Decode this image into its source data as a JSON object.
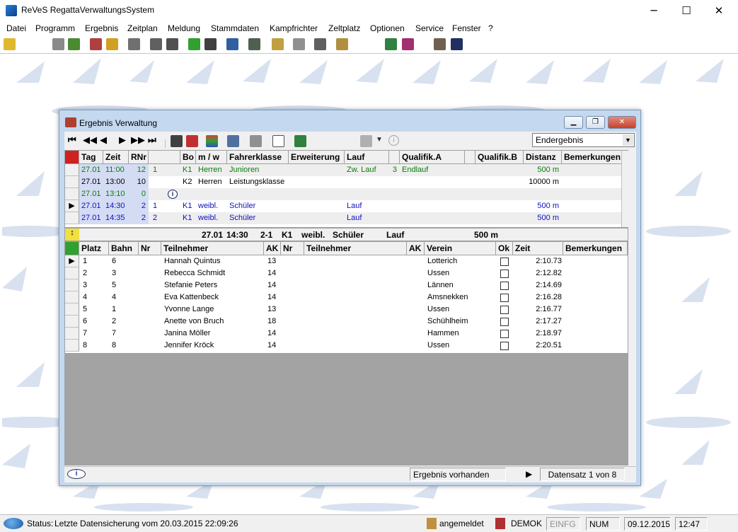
{
  "app": {
    "title": "ReVeS  RegattaVerwaltungsSystem"
  },
  "menu": [
    "Datei",
    "Programm",
    "Ergebnis",
    "Zeitplan",
    "Meldung",
    "Stammdaten",
    "Kampfrichter",
    "Zeltplatz",
    "Optionen",
    "Service",
    "Fenster",
    "?"
  ],
  "child": {
    "title": "Ergebnis Verwaltung",
    "combo_value": "Endergebnis",
    "upper_headers": [
      "Tag",
      "Zeit",
      "RNr",
      "",
      "Bo",
      "m / w",
      "Fahrerklasse",
      "Erweiterung",
      "Lauf",
      "",
      "Qualifik.A",
      "",
      "Qualifik.B",
      "Distanz",
      "Bemerkungen"
    ],
    "upper_rows": [
      {
        "tag": "27.01",
        "zeit": "11:00",
        "rnr": "12",
        "x": "1",
        "bo": "K1",
        "mw": "Herren",
        "klasse": "Junioren",
        "erw": "",
        "lauf": "Zw. Lauf",
        "n": "3",
        "qa": "Endlauf",
        "qb": "",
        "dist": "500 m",
        "color": "#0b7a0b"
      },
      {
        "tag": "27.01",
        "zeit": "13:00",
        "rnr": "10",
        "x": "",
        "bo": "K2",
        "mw": "Herren",
        "klasse": "Leistungsklasse",
        "erw": "",
        "lauf": "",
        "n": "",
        "qa": "",
        "qb": "",
        "dist": "10000 m",
        "color": "#000000"
      },
      {
        "tag": "27.01",
        "zeit": "13:10",
        "rnr": "0",
        "x": "",
        "bo": "",
        "mw": "",
        "klasse": "",
        "erw": "",
        "lauf": "",
        "n": "",
        "qa": "",
        "qb": "",
        "dist": "",
        "color": "#0b7a0b"
      },
      {
        "tag": "27.01",
        "zeit": "14:30",
        "rnr": "2",
        "x": "1",
        "bo": "K1",
        "mw": "weibl.",
        "klasse": "Schüler",
        "erw": "",
        "lauf": "Lauf",
        "n": "",
        "qa": "",
        "qb": "",
        "dist": "500 m",
        "color": "#1010c0"
      },
      {
        "tag": "27.01",
        "zeit": "14:35",
        "rnr": "2",
        "x": "2",
        "bo": "K1",
        "mw": "weibl.",
        "klasse": "Schüler",
        "erw": "",
        "lauf": "Lauf",
        "n": "",
        "qa": "",
        "qb": "",
        "dist": "500 m",
        "color": "#1010c0"
      }
    ],
    "summary": {
      "tag": "27.01",
      "zeit": "14:30",
      "nr": "2-1",
      "bo": "K1",
      "mw": "weibl.",
      "klasse": "Schüler",
      "lauf": "Lauf",
      "dist": "500 m"
    },
    "lower_headers": [
      "Platz",
      "Bahn",
      "Nr",
      "Teilnehmer",
      "AK",
      "Nr",
      "Teilnehmer",
      "AK",
      "Verein",
      "Ok",
      "Zeit",
      "Bemerkungen"
    ],
    "lower_rows": [
      {
        "platz": "1",
        "bahn": "6",
        "name": "Hannah Quintus",
        "ak": "13",
        "verein": "Lotterich",
        "zeit": "2:10.73"
      },
      {
        "platz": "2",
        "bahn": "3",
        "name": "Rebecca Schmidt",
        "ak": "14",
        "verein": "Ussen",
        "zeit": "2:12.82"
      },
      {
        "platz": "3",
        "bahn": "5",
        "name": "Stefanie Peters",
        "ak": "14",
        "verein": "Lännen",
        "zeit": "2:14.69"
      },
      {
        "platz": "4",
        "bahn": "4",
        "name": "Eva Kattenbeck",
        "ak": "14",
        "verein": "Amsnekken",
        "zeit": "2:16.28"
      },
      {
        "platz": "5",
        "bahn": "1",
        "name": "Yvonne Lange",
        "ak": "13",
        "verein": "Ussen",
        "zeit": "2:16.77"
      },
      {
        "platz": "6",
        "bahn": "2",
        "name": "Anette von Bruch",
        "ak": "18",
        "verein": "Schühlheim",
        "zeit": "2:17.27"
      },
      {
        "platz": "7",
        "bahn": "7",
        "name": "Janina Möller",
        "ak": "14",
        "verein": "Hammen",
        "zeit": "2:18.97"
      },
      {
        "platz": "8",
        "bahn": "8",
        "name": "Jennifer Kröck",
        "ak": "14",
        "verein": "Ussen",
        "zeit": "2:20.51"
      }
    ],
    "status_text": "Ergebnis vorhanden",
    "record_text": "Datensatz  1 von  8"
  },
  "status": {
    "label": "Status:",
    "text": "Letzte Datensicherung vom  20.03.2015  22:09:26",
    "login": "angemeldet",
    "demo": "DEMOK",
    "einfg": "EINFG",
    "num": "NUM",
    "date": "09.12.2015",
    "time": "12:47"
  }
}
